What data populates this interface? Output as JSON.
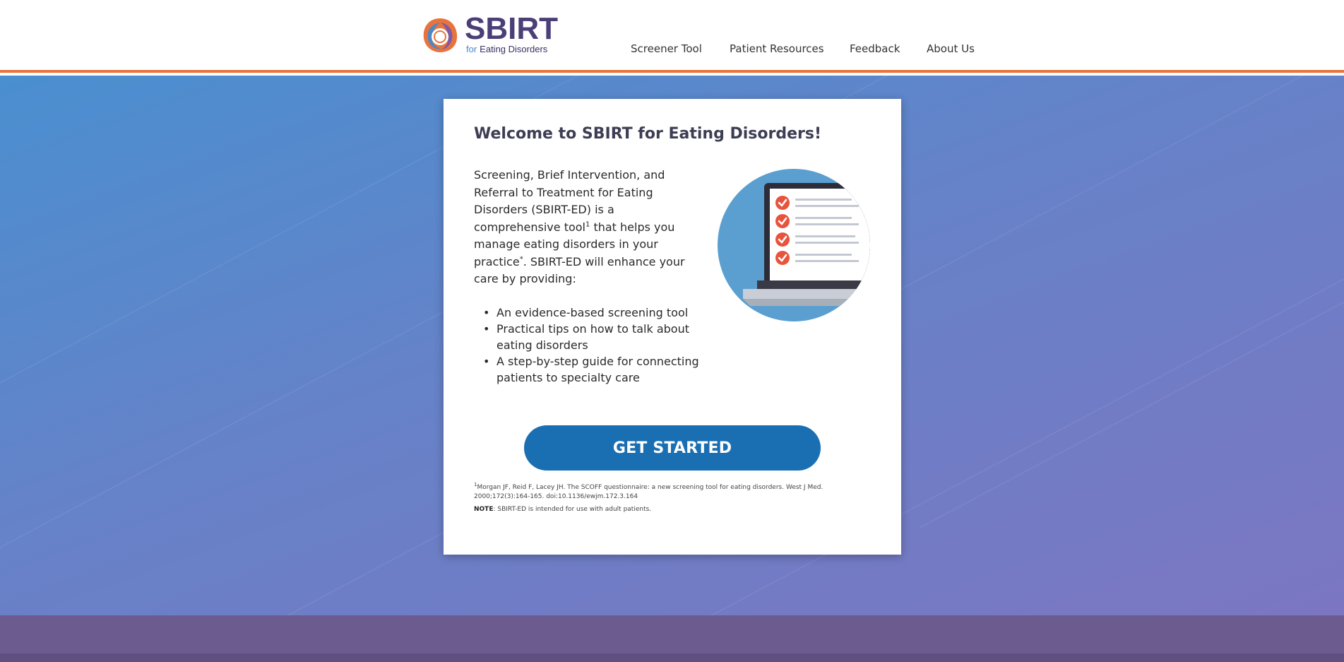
{
  "brand": {
    "title": "SBIRT",
    "sub_for": "for",
    "sub_rest": "Eating Disorders",
    "logo_colors": [
      "#e8733d",
      "#4a88c8",
      "#7b5aa6"
    ]
  },
  "nav": {
    "items": [
      "Screener Tool",
      "Patient Resources",
      "Feedback",
      "About Us"
    ]
  },
  "colors": {
    "accent": "#e8733d",
    "hero_start": "#4a8fd0",
    "hero_end": "#7c76c2",
    "cta": "#1a6fb3",
    "footer": "#6c5b8e"
  },
  "card": {
    "title": "Welcome to SBIRT for Eating Disorders!",
    "intro_part1": "Screening, Brief Intervention, and Referral to Treatment for Eating Disorders (SBIRT-ED) is a comprehensive tool",
    "intro_sup1": "1",
    "intro_part2": " that helps you manage eating disorders in your practice",
    "intro_sup2": "*",
    "intro_part3": ". SBIRT-ED will enhance your care by providing:",
    "bullets": [
      "An evidence-based screening tool",
      "Practical tips on how to talk about eating disorders",
      "A step-by-step guide for connecting patients to specialty care"
    ],
    "illustration_icon": "laptop-checklist-icon",
    "cta_label": "GET STARTED",
    "footnote_sup": "1",
    "footnote_text": "Morgan JF, Reid F, Lacey JH. The SCOFF questionnaire: a new screening tool for eating disorders. West J Med. 2000;172(3):164-165. doi:10.1136/ewjm.172.3.164",
    "note_label": "NOTE",
    "note_text": ": SBIRT-ED is intended for use with adult patients."
  }
}
